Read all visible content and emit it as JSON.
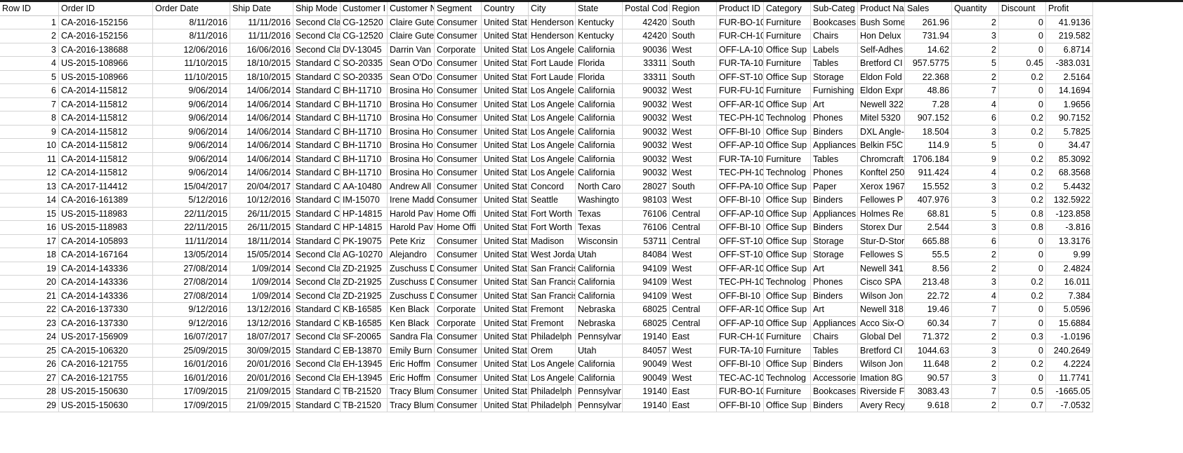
{
  "headers": [
    "Row ID",
    "Order ID",
    "Order Date",
    "Ship Date",
    "Ship Mode",
    "Customer I",
    "Customer N",
    "Segment",
    "Country",
    "City",
    "State",
    "Postal Cod",
    "Region",
    "Product ID",
    "Category",
    "Sub-Categ",
    "Product Na",
    "Sales",
    "Quantity",
    "Discount",
    "Profit"
  ],
  "rows": [
    [
      "1",
      "CA-2016-152156",
      "8/11/2016",
      "11/11/2016",
      "Second Cla",
      "CG-12520",
      "Claire Gute",
      "Consumer",
      "United Stat",
      "Henderson",
      "Kentucky",
      "42420",
      "South",
      "FUR-BO-10",
      "Furniture",
      "Bookcases",
      "Bush Some",
      "261.96",
      "2",
      "0",
      "41.9136"
    ],
    [
      "2",
      "CA-2016-152156",
      "8/11/2016",
      "11/11/2016",
      "Second Cla",
      "CG-12520",
      "Claire Gute",
      "Consumer",
      "United Stat",
      "Henderson",
      "Kentucky",
      "42420",
      "South",
      "FUR-CH-10",
      "Furniture",
      "Chairs",
      "Hon Delux",
      "731.94",
      "3",
      "0",
      "219.582"
    ],
    [
      "3",
      "CA-2016-138688",
      "12/06/2016",
      "16/06/2016",
      "Second Cla",
      "DV-13045",
      "Darrin Van",
      "Corporate",
      "United Stat",
      "Los Angele",
      "California",
      "90036",
      "West",
      "OFF-LA-10",
      "Office Sup",
      "Labels",
      "Self-Adhes",
      "14.62",
      "2",
      "0",
      "6.8714"
    ],
    [
      "4",
      "US-2015-108966",
      "11/10/2015",
      "18/10/2015",
      "Standard C",
      "SO-20335",
      "Sean O'Do",
      "Consumer",
      "United Stat",
      "Fort Laude",
      "Florida",
      "33311",
      "South",
      "FUR-TA-10",
      "Furniture",
      "Tables",
      "Bretford CI",
      "957.5775",
      "5",
      "0.45",
      "-383.031"
    ],
    [
      "5",
      "US-2015-108966",
      "11/10/2015",
      "18/10/2015",
      "Standard C",
      "SO-20335",
      "Sean O'Do",
      "Consumer",
      "United Stat",
      "Fort Laude",
      "Florida",
      "33311",
      "South",
      "OFF-ST-10",
      "Office Sup",
      "Storage",
      "Eldon Fold",
      "22.368",
      "2",
      "0.2",
      "2.5164"
    ],
    [
      "6",
      "CA-2014-115812",
      "9/06/2014",
      "14/06/2014",
      "Standard C",
      "BH-11710",
      "Brosina Ho",
      "Consumer",
      "United Stat",
      "Los Angele",
      "California",
      "90032",
      "West",
      "FUR-FU-10",
      "Furniture",
      "Furnishing",
      "Eldon Expr",
      "48.86",
      "7",
      "0",
      "14.1694"
    ],
    [
      "7",
      "CA-2014-115812",
      "9/06/2014",
      "14/06/2014",
      "Standard C",
      "BH-11710",
      "Brosina Ho",
      "Consumer",
      "United Stat",
      "Los Angele",
      "California",
      "90032",
      "West",
      "OFF-AR-10",
      "Office Sup",
      "Art",
      "Newell 322",
      "7.28",
      "4",
      "0",
      "1.9656"
    ],
    [
      "8",
      "CA-2014-115812",
      "9/06/2014",
      "14/06/2014",
      "Standard C",
      "BH-11710",
      "Brosina Ho",
      "Consumer",
      "United Stat",
      "Los Angele",
      "California",
      "90032",
      "West",
      "TEC-PH-10",
      "Technolog",
      "Phones",
      "Mitel 5320",
      "907.152",
      "6",
      "0.2",
      "90.7152"
    ],
    [
      "9",
      "CA-2014-115812",
      "9/06/2014",
      "14/06/2014",
      "Standard C",
      "BH-11710",
      "Brosina Ho",
      "Consumer",
      "United Stat",
      "Los Angele",
      "California",
      "90032",
      "West",
      "OFF-BI-10",
      "Office Sup",
      "Binders",
      "DXL Angle-",
      "18.504",
      "3",
      "0.2",
      "5.7825"
    ],
    [
      "10",
      "CA-2014-115812",
      "9/06/2014",
      "14/06/2014",
      "Standard C",
      "BH-11710",
      "Brosina Ho",
      "Consumer",
      "United Stat",
      "Los Angele",
      "California",
      "90032",
      "West",
      "OFF-AP-10",
      "Office Sup",
      "Appliances",
      "Belkin F5C",
      "114.9",
      "5",
      "0",
      "34.47"
    ],
    [
      "11",
      "CA-2014-115812",
      "9/06/2014",
      "14/06/2014",
      "Standard C",
      "BH-11710",
      "Brosina Ho",
      "Consumer",
      "United Stat",
      "Los Angele",
      "California",
      "90032",
      "West",
      "FUR-TA-10",
      "Furniture",
      "Tables",
      "Chromcraft",
      "1706.184",
      "9",
      "0.2",
      "85.3092"
    ],
    [
      "12",
      "CA-2014-115812",
      "9/06/2014",
      "14/06/2014",
      "Standard C",
      "BH-11710",
      "Brosina Ho",
      "Consumer",
      "United Stat",
      "Los Angele",
      "California",
      "90032",
      "West",
      "TEC-PH-10",
      "Technolog",
      "Phones",
      "Konftel 250",
      "911.424",
      "4",
      "0.2",
      "68.3568"
    ],
    [
      "13",
      "CA-2017-114412",
      "15/04/2017",
      "20/04/2017",
      "Standard C",
      "AA-10480",
      "Andrew All",
      "Consumer",
      "United Stat",
      "Concord",
      "North Caro",
      "28027",
      "South",
      "OFF-PA-10",
      "Office Sup",
      "Paper",
      "Xerox 1967",
      "15.552",
      "3",
      "0.2",
      "5.4432"
    ],
    [
      "14",
      "CA-2016-161389",
      "5/12/2016",
      "10/12/2016",
      "Standard C",
      "IM-15070",
      "Irene Madd",
      "Consumer",
      "United Stat",
      "Seattle",
      "Washingto",
      "98103",
      "West",
      "OFF-BI-10",
      "Office Sup",
      "Binders",
      "Fellowes P",
      "407.976",
      "3",
      "0.2",
      "132.5922"
    ],
    [
      "15",
      "US-2015-118983",
      "22/11/2015",
      "26/11/2015",
      "Standard C",
      "HP-14815",
      "Harold Pav",
      "Home Offi",
      "United Stat",
      "Fort Worth",
      "Texas",
      "76106",
      "Central",
      "OFF-AP-10",
      "Office Sup",
      "Appliances",
      "Holmes Re",
      "68.81",
      "5",
      "0.8",
      "-123.858"
    ],
    [
      "16",
      "US-2015-118983",
      "22/11/2015",
      "26/11/2015",
      "Standard C",
      "HP-14815",
      "Harold Pav",
      "Home Offi",
      "United Stat",
      "Fort Worth",
      "Texas",
      "76106",
      "Central",
      "OFF-BI-10",
      "Office Sup",
      "Binders",
      "Storex Dur",
      "2.544",
      "3",
      "0.8",
      "-3.816"
    ],
    [
      "17",
      "CA-2014-105893",
      "11/11/2014",
      "18/11/2014",
      "Standard C",
      "PK-19075",
      "Pete Kriz",
      "Consumer",
      "United Stat",
      "Madison",
      "Wisconsin",
      "53711",
      "Central",
      "OFF-ST-10",
      "Office Sup",
      "Storage",
      "Stur-D-Stor",
      "665.88",
      "6",
      "0",
      "13.3176"
    ],
    [
      "18",
      "CA-2014-167164",
      "13/05/2014",
      "15/05/2014",
      "Second Cla",
      "AG-10270",
      "Alejandro",
      "Consumer",
      "United Stat",
      "West Jorda",
      "Utah",
      "84084",
      "West",
      "OFF-ST-10",
      "Office Sup",
      "Storage",
      "Fellowes S",
      "55.5",
      "2",
      "0",
      "9.99"
    ],
    [
      "19",
      "CA-2014-143336",
      "27/08/2014",
      "1/09/2014",
      "Second Cla",
      "ZD-21925",
      "Zuschuss D",
      "Consumer",
      "United Stat",
      "San Francis",
      "California",
      "94109",
      "West",
      "OFF-AR-10",
      "Office Sup",
      "Art",
      "Newell 341",
      "8.56",
      "2",
      "0",
      "2.4824"
    ],
    [
      "20",
      "CA-2014-143336",
      "27/08/2014",
      "1/09/2014",
      "Second Cla",
      "ZD-21925",
      "Zuschuss D",
      "Consumer",
      "United Stat",
      "San Francis",
      "California",
      "94109",
      "West",
      "TEC-PH-10",
      "Technolog",
      "Phones",
      "Cisco SPA",
      "213.48",
      "3",
      "0.2",
      "16.011"
    ],
    [
      "21",
      "CA-2014-143336",
      "27/08/2014",
      "1/09/2014",
      "Second Cla",
      "ZD-21925",
      "Zuschuss D",
      "Consumer",
      "United Stat",
      "San Francis",
      "California",
      "94109",
      "West",
      "OFF-BI-10",
      "Office Sup",
      "Binders",
      "Wilson Jon",
      "22.72",
      "4",
      "0.2",
      "7.384"
    ],
    [
      "22",
      "CA-2016-137330",
      "9/12/2016",
      "13/12/2016",
      "Standard C",
      "KB-16585",
      "Ken Black",
      "Corporate",
      "United Stat",
      "Fremont",
      "Nebraska",
      "68025",
      "Central",
      "OFF-AR-10",
      "Office Sup",
      "Art",
      "Newell 318",
      "19.46",
      "7",
      "0",
      "5.0596"
    ],
    [
      "23",
      "CA-2016-137330",
      "9/12/2016",
      "13/12/2016",
      "Standard C",
      "KB-16585",
      "Ken Black",
      "Corporate",
      "United Stat",
      "Fremont",
      "Nebraska",
      "68025",
      "Central",
      "OFF-AP-10",
      "Office Sup",
      "Appliances",
      "Acco Six-O",
      "60.34",
      "7",
      "0",
      "15.6884"
    ],
    [
      "24",
      "US-2017-156909",
      "16/07/2017",
      "18/07/2017",
      "Second Cla",
      "SF-20065",
      "Sandra Fla",
      "Consumer",
      "United Stat",
      "Philadelph",
      "Pennsylvar",
      "19140",
      "East",
      "FUR-CH-10",
      "Furniture",
      "Chairs",
      "Global Del",
      "71.372",
      "2",
      "0.3",
      "-1.0196"
    ],
    [
      "25",
      "CA-2015-106320",
      "25/09/2015",
      "30/09/2015",
      "Standard C",
      "EB-13870",
      "Emily Burn",
      "Consumer",
      "United Stat",
      "Orem",
      "Utah",
      "84057",
      "West",
      "FUR-TA-10",
      "Furniture",
      "Tables",
      "Bretford CI",
      "1044.63",
      "3",
      "0",
      "240.2649"
    ],
    [
      "26",
      "CA-2016-121755",
      "16/01/2016",
      "20/01/2016",
      "Second Cla",
      "EH-13945",
      "Eric Hoffm",
      "Consumer",
      "United Stat",
      "Los Angele",
      "California",
      "90049",
      "West",
      "OFF-BI-10",
      "Office Sup",
      "Binders",
      "Wilson Jon",
      "11.648",
      "2",
      "0.2",
      "4.2224"
    ],
    [
      "27",
      "CA-2016-121755",
      "16/01/2016",
      "20/01/2016",
      "Second Cla",
      "EH-13945",
      "Eric Hoffm",
      "Consumer",
      "United Stat",
      "Los Angele",
      "California",
      "90049",
      "West",
      "TEC-AC-10",
      "Technolog",
      "Accessorie",
      "Imation 8G",
      "90.57",
      "3",
      "0",
      "11.7741"
    ],
    [
      "28",
      "US-2015-150630",
      "17/09/2015",
      "21/09/2015",
      "Standard C",
      "TB-21520",
      "Tracy Blum",
      "Consumer",
      "United Stat",
      "Philadelph",
      "Pennsylvar",
      "19140",
      "East",
      "FUR-BO-10",
      "Furniture",
      "Bookcases",
      "Riverside F",
      "3083.43",
      "7",
      "0.5",
      "-1665.05"
    ],
    [
      "29",
      "US-2015-150630",
      "17/09/2015",
      "21/09/2015",
      "Standard C",
      "TB-21520",
      "Tracy Blum",
      "Consumer",
      "United Stat",
      "Philadelph",
      "Pennsylvar",
      "19140",
      "East",
      "OFF-BI-10",
      "Office Sup",
      "Binders",
      "Avery Recy",
      "9.618",
      "2",
      "0.7",
      "-7.0532"
    ]
  ]
}
